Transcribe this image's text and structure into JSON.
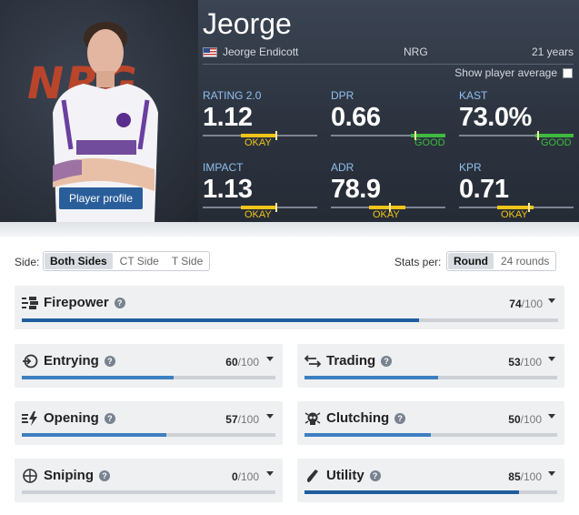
{
  "player": {
    "nickname": "Jeorge",
    "real_name": "Jeorge Endicott",
    "team": "NRG",
    "age": "21 years",
    "profile_button": "Player profile",
    "team_logo_text": "NRG"
  },
  "show_average": {
    "label": "Show player average",
    "checked": false
  },
  "stats": [
    {
      "label": "RATING 2.0",
      "value": "1.12",
      "verdict": "OKAY"
    },
    {
      "label": "DPR",
      "value": "0.66",
      "verdict": "GOOD"
    },
    {
      "label": "KAST",
      "value": "73.0%",
      "verdict": "GOOD"
    },
    {
      "label": "IMPACT",
      "value": "1.13",
      "verdict": "OKAY"
    },
    {
      "label": "ADR",
      "value": "78.9",
      "verdict": "OKAY"
    },
    {
      "label": "KPR",
      "value": "0.71",
      "verdict": "OKAY"
    }
  ],
  "filters": {
    "side_label": "Side:",
    "side_options": [
      "Both Sides",
      "CT Side",
      "T Side"
    ],
    "side_selected": "Both Sides",
    "per_label": "Stats per:",
    "per_options": [
      "Round",
      "24 rounds"
    ],
    "per_selected": "Round"
  },
  "categories": [
    {
      "name": "Firepower",
      "score": "74",
      "max": "/100",
      "icon": "firepower-icon"
    },
    {
      "name": "Entrying",
      "score": "60",
      "max": "/100",
      "icon": "entrying-icon"
    },
    {
      "name": "Trading",
      "score": "53",
      "max": "/100",
      "icon": "trading-icon"
    },
    {
      "name": "Opening",
      "score": "57",
      "max": "/100",
      "icon": "opening-icon"
    },
    {
      "name": "Clutching",
      "score": "50",
      "max": "/100",
      "icon": "clutching-icon"
    },
    {
      "name": "Sniping",
      "score": "0",
      "max": "/100",
      "icon": "sniping-icon"
    },
    {
      "name": "Utility",
      "score": "85",
      "max": "/100",
      "icon": "utility-icon"
    }
  ],
  "colors": {
    "okay": "#f0c419",
    "good": "#3fba3f",
    "bar_mid": "#3e7fc1",
    "bar_high": "#1f5d9e",
    "header_label": "#8fc0ef",
    "profile_button": "#2a5e9b"
  }
}
